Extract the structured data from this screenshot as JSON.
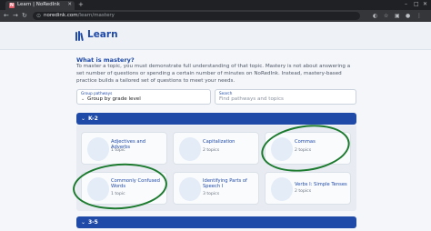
{
  "browser": {
    "tab_title": "Learn | NoRedInk",
    "url_host": "noredink.com",
    "url_path": "/learn/mastery",
    "favicon_letter": "N"
  },
  "header": {
    "logo_text": "Learn"
  },
  "intro": {
    "title": "What is mastery?",
    "text": "To master a topic, you must demonstrate full understanding of that topic. Mastery is not about answering a set number of questions or spending a certain number of minutes on NoRedInk. Instead, mastery-based practice builds a tailored set of questions to meet your needs."
  },
  "filters": {
    "group_label": "Group pathways",
    "group_value": "Group by grade level",
    "search_label": "Search",
    "search_placeholder": "Find pathways and topics"
  },
  "sections": [
    {
      "label": "K-2",
      "expanded": true,
      "cards": [
        {
          "title": "Adjectives and Adverbs",
          "subtitle": "1 topic"
        },
        {
          "title": "Capitalization",
          "subtitle": "2 topics"
        },
        {
          "title": "Commas",
          "subtitle": "2 topics"
        },
        {
          "title": "Commonly Confused Words",
          "subtitle": "1 topic"
        },
        {
          "title": "Identifying Parts of Speech I",
          "subtitle": "3 topics"
        },
        {
          "title": "Verbs I: Simple Tenses",
          "subtitle": "2 topics"
        }
      ]
    },
    {
      "label": "3-5",
      "expanded": false
    }
  ],
  "colors": {
    "brand_blue": "#1f4aa8",
    "annotation_green": "#1b7a2e"
  }
}
